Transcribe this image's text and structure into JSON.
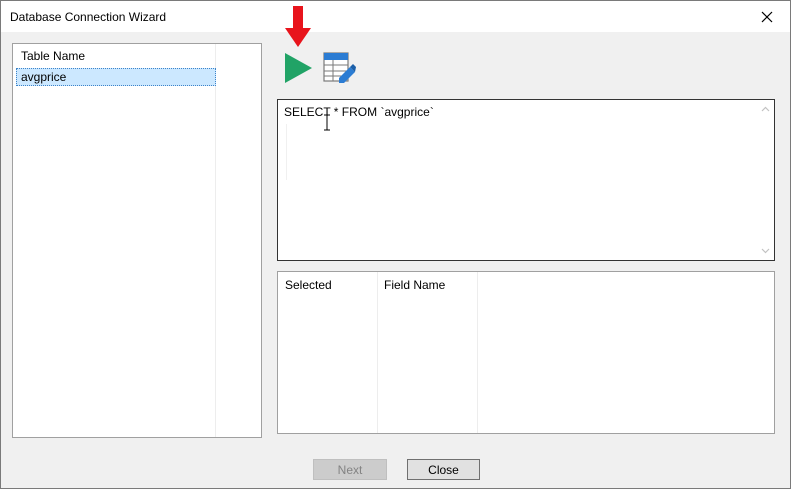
{
  "window": {
    "title": "Database Connection Wizard"
  },
  "table_list": {
    "header": "Table Name",
    "items": [
      {
        "label": "avgprice",
        "selected": true
      }
    ]
  },
  "toolbar": {
    "run_icon": "play-icon",
    "design_icon": "query-designer-icon",
    "annotation_arrow_color": "#e8141c"
  },
  "sql_editor": {
    "value": "SELECT * FROM `avgprice`"
  },
  "field_list": {
    "columns": [
      "Selected",
      "Field Name"
    ]
  },
  "buttons": {
    "next_label": "Next",
    "close_label": "Close"
  },
  "colors": {
    "run_green": "#21a366",
    "selection_bg": "#cce8ff",
    "arrow_red": "#e8141c"
  }
}
